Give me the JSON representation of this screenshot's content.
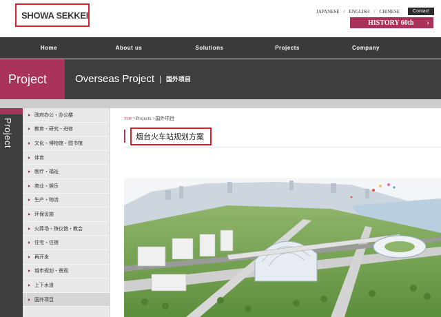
{
  "header": {
    "logo_text": "SHOWA SEKKEI",
    "languages": [
      "JAPANESE",
      "ENGLISH",
      "CHINESE"
    ],
    "contact_label": "Contact",
    "history_label": "HISTORY 60th",
    "history_icon": "chevron-right-icon"
  },
  "nav": {
    "items": [
      "Home",
      "About us",
      "Solutions",
      "Projects",
      "Company"
    ]
  },
  "banner": {
    "tab_label": "Project",
    "title": "Overseas Project",
    "subtitle": "国外项目"
  },
  "sidebar": {
    "vertical_label": "Project",
    "items": [
      "政府办公・办公楼",
      "教育・研究・进修",
      "文化・博物馆・图书馆",
      "体育",
      "医疗・福祉",
      "商业・娱乐",
      "生产・物流",
      "环保设施",
      "火葬场・殡仪馆・教会",
      "住宅・住宿",
      "再开发",
      "城市规划・景观",
      "上下水道",
      "国外项目"
    ],
    "active_index": 13
  },
  "breadcrumb": {
    "top": "TOP",
    "projects": "Projects",
    "current": "国外项目"
  },
  "page": {
    "title": "烟台火车站规划方案"
  },
  "colors": {
    "accent": "#a8325a",
    "highlight_border": "#d8202f",
    "nav_bg": "#3a3a3a",
    "banner_bg": "#3e3e3e",
    "sidebar_bg": "#e8e8e8"
  }
}
